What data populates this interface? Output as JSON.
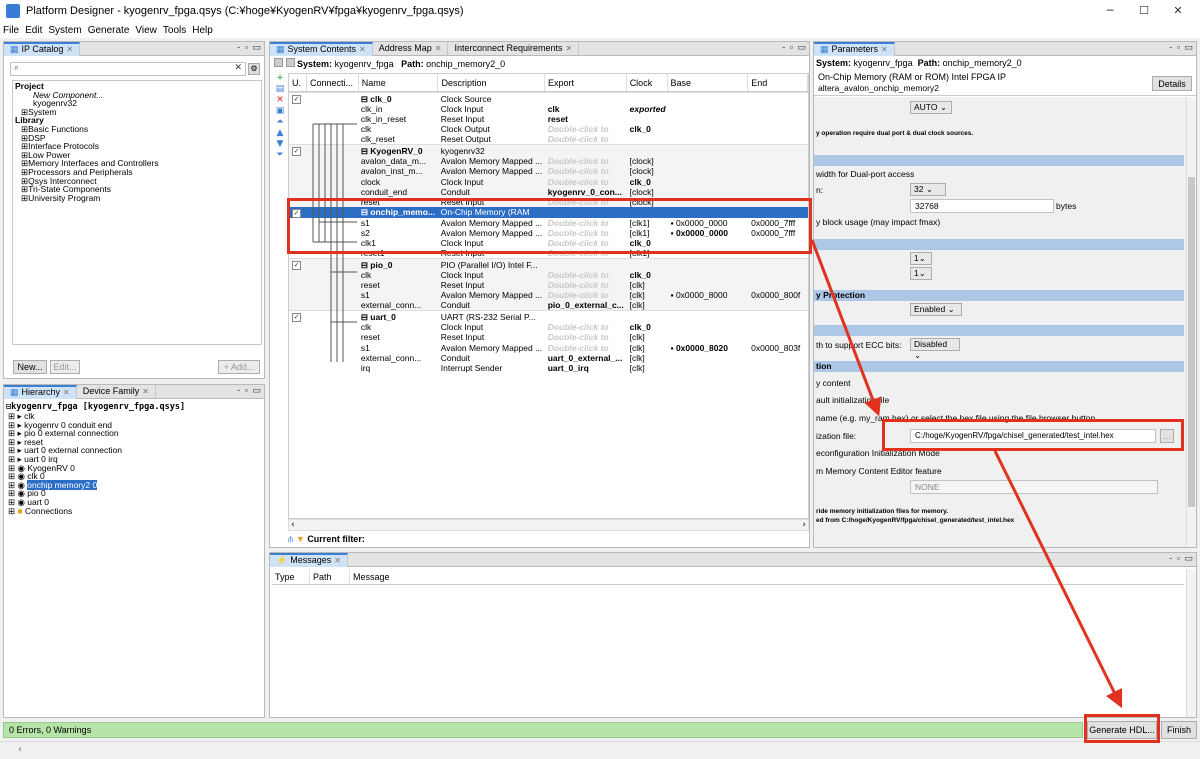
{
  "window": {
    "title": "Platform Designer - kyogenrv_fpga.qsys (C:¥hoge¥KyogenRV¥fpga¥kyogenrv_fpga.qsys)",
    "minimize": "─",
    "maximize": "☐",
    "close": "✕"
  },
  "menu": [
    "File",
    "Edit",
    "System",
    "Generate",
    "View",
    "Tools",
    "Help"
  ],
  "ipcatalog": {
    "tab": "IP Catalog",
    "search_value": "",
    "tree": [
      "Project",
      "New Component...",
      "kyogenrv32",
      "System",
      "Library",
      "Basic Functions",
      "DSP",
      "Interface Protocols",
      "Low Power",
      "Memory Interfaces and Controllers",
      "Processors and Peripherals",
      "Qsys Interconnect",
      "Tri-State Components",
      "University Program"
    ],
    "btn_new": "New...",
    "btn_edit": "Edit...",
    "btn_add": "+ Add..."
  },
  "hierarchy": {
    "tabs": [
      "Hierarchy",
      "Device Family"
    ],
    "root": "kyogenrv_fpga [kyogenrv_fpga.qsys]",
    "items": [
      "clk",
      "kyogenrv 0 conduit end",
      "pio 0 external connection",
      "reset",
      "uart 0 external connection",
      "uart 0 irq",
      "KyogenRV 0",
      "clk 0",
      "onchip memory2 0",
      "pio 0",
      "uart 0",
      "Connections"
    ]
  },
  "system": {
    "tabs": [
      "System Contents",
      "Address Map",
      "Interconnect Requirements"
    ],
    "system_label": "System:",
    "system_name": "kyogenrv_fpga",
    "path_label": "Path:",
    "path_value": "onchip_memory2_0",
    "columns": [
      "U.",
      "Connecti...",
      "Name",
      "Description",
      "Export",
      "Clock",
      "Base",
      "End"
    ],
    "rows": [
      {
        "name": "clk_0",
        "desc": "Clock Source",
        "export": "",
        "clock": "",
        "base": "",
        "end": "",
        "group": true
      },
      {
        "name": "clk_in",
        "desc": "Clock Input",
        "export": "clk",
        "clock": "exported",
        "base": "",
        "end": ""
      },
      {
        "name": "clk_in_reset",
        "desc": "Reset Input",
        "export": "reset",
        "clock": "",
        "base": "",
        "end": ""
      },
      {
        "name": "clk",
        "desc": "Clock Output",
        "export": "Double-click to",
        "clock": "clk_0",
        "base": "",
        "end": ""
      },
      {
        "name": "clk_reset",
        "desc": "Reset Output",
        "export": "Double-click to",
        "clock": "",
        "base": "",
        "end": ""
      },
      {
        "name": "KyogenRV_0",
        "desc": "kyogenrv32",
        "export": "",
        "clock": "",
        "base": "",
        "end": "",
        "group": true
      },
      {
        "name": "avalon_data_m...",
        "desc": "Avalon Memory Mapped ...",
        "export": "Double-click to",
        "clock": "[clock]",
        "base": "",
        "end": ""
      },
      {
        "name": "avalon_inst_m...",
        "desc": "Avalon Memory Mapped ...",
        "export": "Double-click to",
        "clock": "[clock]",
        "base": "",
        "end": ""
      },
      {
        "name": "clock",
        "desc": "Clock Input",
        "export": "Double-click to",
        "clock": "clk_0",
        "base": "",
        "end": ""
      },
      {
        "name": "conduit_end",
        "desc": "Conduit",
        "export": "kyogenrv_0_con...",
        "clock": "[clock]",
        "base": "",
        "end": ""
      },
      {
        "name": "reset",
        "desc": "Reset Input",
        "export": "Double-click to",
        "clock": "[clock]",
        "base": "",
        "end": ""
      },
      {
        "name": "onchip_memo...",
        "desc": "On-Chip Memory (RAM",
        "export": "",
        "clock": "",
        "base": "",
        "end": "",
        "group": true,
        "selected": true
      },
      {
        "name": "s1",
        "desc": "Avalon Memory Mapped ...",
        "export": "Double-click to",
        "clock": "[clk1]",
        "base": "0x0000_0000",
        "end": "0x0000_7fff"
      },
      {
        "name": "s2",
        "desc": "Avalon Memory Mapped ...",
        "export": "Double-click to",
        "clock": "[clk1]",
        "base": "0x0000_0000",
        "end": "0x0000_7fff",
        "boldbase": true
      },
      {
        "name": "clk1",
        "desc": "Clock Input",
        "export": "Double-click to",
        "clock": "clk_0",
        "base": "",
        "end": ""
      },
      {
        "name": "reset1",
        "desc": "Reset Input",
        "export": "Double-click to",
        "clock": "[clk1]",
        "base": "",
        "end": ""
      },
      {
        "name": "pio_0",
        "desc": "PIO (Parallel I/O) Intel F...",
        "export": "",
        "clock": "",
        "base": "",
        "end": "",
        "group": true
      },
      {
        "name": "clk",
        "desc": "Clock Input",
        "export": "Double-click to",
        "clock": "clk_0",
        "base": "",
        "end": ""
      },
      {
        "name": "reset",
        "desc": "Reset Input",
        "export": "Double-click to",
        "clock": "[clk]",
        "base": "",
        "end": ""
      },
      {
        "name": "s1",
        "desc": "Avalon Memory Mapped ...",
        "export": "Double-click to",
        "clock": "[clk]",
        "base": "0x0000_8000",
        "end": "0x0000_800f"
      },
      {
        "name": "external_conn...",
        "desc": "Conduit",
        "export": "pio_0_external_c...",
        "clock": "[clk]",
        "base": "",
        "end": ""
      },
      {
        "name": "uart_0",
        "desc": "UART (RS-232 Serial P...",
        "export": "",
        "clock": "",
        "base": "",
        "end": "",
        "group": true
      },
      {
        "name": "clk",
        "desc": "Clock Input",
        "export": "Double-click to",
        "clock": "clk_0",
        "base": "",
        "end": ""
      },
      {
        "name": "reset",
        "desc": "Reset Input",
        "export": "Double-click to",
        "clock": "[clk]",
        "base": "",
        "end": ""
      },
      {
        "name": "s1",
        "desc": "Avalon Memory Mapped ...",
        "export": "Double-click to",
        "clock": "[clk]",
        "base": "0x0000_8020",
        "end": "0x0000_803f",
        "boldbase": true
      },
      {
        "name": "external_conn...",
        "desc": "Conduit",
        "export": "uart_0_external_...",
        "clock": "[clk]",
        "base": "",
        "end": ""
      },
      {
        "name": "irq",
        "desc": "Interrupt Sender",
        "export": "uart_0_irq",
        "clock": "[clk]",
        "base": "",
        "end": ""
      }
    ],
    "filter_label": "Current filter:"
  },
  "parameters": {
    "tab": "Parameters",
    "system_label": "System:",
    "system_name": "kyogenrv_fpga",
    "path_label": "Path:",
    "path_value": "onchip_memory2_0",
    "component_title": "On-Chip Memory (RAM or ROM) Intel FPGA IP",
    "component_id": "altera_avalon_onchip_memory2",
    "details": "Details",
    "auto": "AUTO",
    "note_dual": "y operation require dual port & dual clock sources.",
    "dual_width": "width for Dual-port access",
    "n_label": "n:",
    "width_val": "32",
    "size_val": "32768",
    "bytes": "bytes",
    "block_usage": "y block usage (may impact fmax)",
    "one_a": "1",
    "one_b": "1",
    "sec_protection": "y Protection",
    "enabled": "Enabled",
    "ecc_label": "th to support ECC bits:",
    "disabled": "Disabled",
    "sec_init": "tion",
    "content": "y content",
    "default_init": "ault initialization file",
    "hexname": "name (e.g. my_ram.hex) or select the hex file using the file browser button.",
    "init_file_label": "ization file:",
    "init_file_value": "C:/hoge/KyogenRV/fpga/chisel_generated/test_intel.hex",
    "reconfig": "econfiguration Initialization Mode",
    "editor": "m Memory Content Editor feature",
    "none": "NONE",
    "note1": "ride memory initialization files for memory.",
    "note2": "ed from C:/hoge/KyogenRV/fpga/chisel_generated/test_intel.hex"
  },
  "messages": {
    "tab": "Messages",
    "cols": [
      "Type",
      "Path",
      "Message"
    ]
  },
  "status": {
    "text": "0 Errors, 0 Warnings",
    "generate": "Generate HDL...",
    "finish": "Finish"
  },
  "colors": {
    "highlight": "#e0321e",
    "status_green": "#b6e3a8",
    "selection": "#2c6ec6",
    "section": "#adc8e6"
  }
}
